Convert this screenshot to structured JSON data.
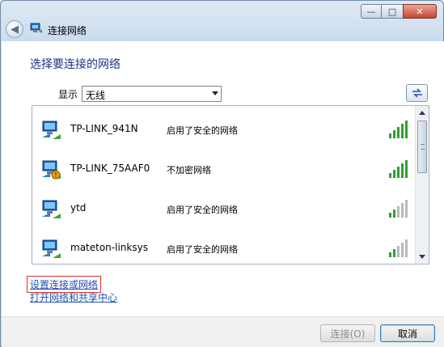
{
  "window": {
    "title": "连接网络",
    "controls": {
      "minimize": "—",
      "maximize": "□",
      "close": "✕"
    }
  },
  "page": {
    "heading": "选择要连接的网络",
    "show_label": "显示",
    "show_select": {
      "value": "无线"
    }
  },
  "networks": [
    {
      "ssid": "TP-LINK_941N",
      "security": "启用了安全的网络",
      "signal_bars": 5,
      "secured": true
    },
    {
      "ssid": "TP-LINK_75AAF0",
      "security": "不加密网络",
      "signal_bars": 5,
      "secured": false
    },
    {
      "ssid": "ytd",
      "security": "启用了安全的网络",
      "signal_bars": 2,
      "secured": true
    },
    {
      "ssid": "mateton-linksys",
      "security": "启用了安全的网络",
      "signal_bars": 2,
      "secured": true
    }
  ],
  "links": {
    "setup": "设置连接或网络",
    "network_center": "打开网络和共享中心"
  },
  "buttons": {
    "connect": "连接(O)",
    "cancel": "取消"
  },
  "colors": {
    "heading": "#1e3287",
    "link": "#1f4fb5",
    "signal_active": "#2fa12f",
    "signal_inactive": "#b9b9b9",
    "highlight_border": "#d9302c"
  },
  "icons": {
    "network": "network-computer-icon",
    "warning": "warning-shield-icon",
    "refresh": "refresh-icon",
    "back": "back-arrow-icon"
  }
}
